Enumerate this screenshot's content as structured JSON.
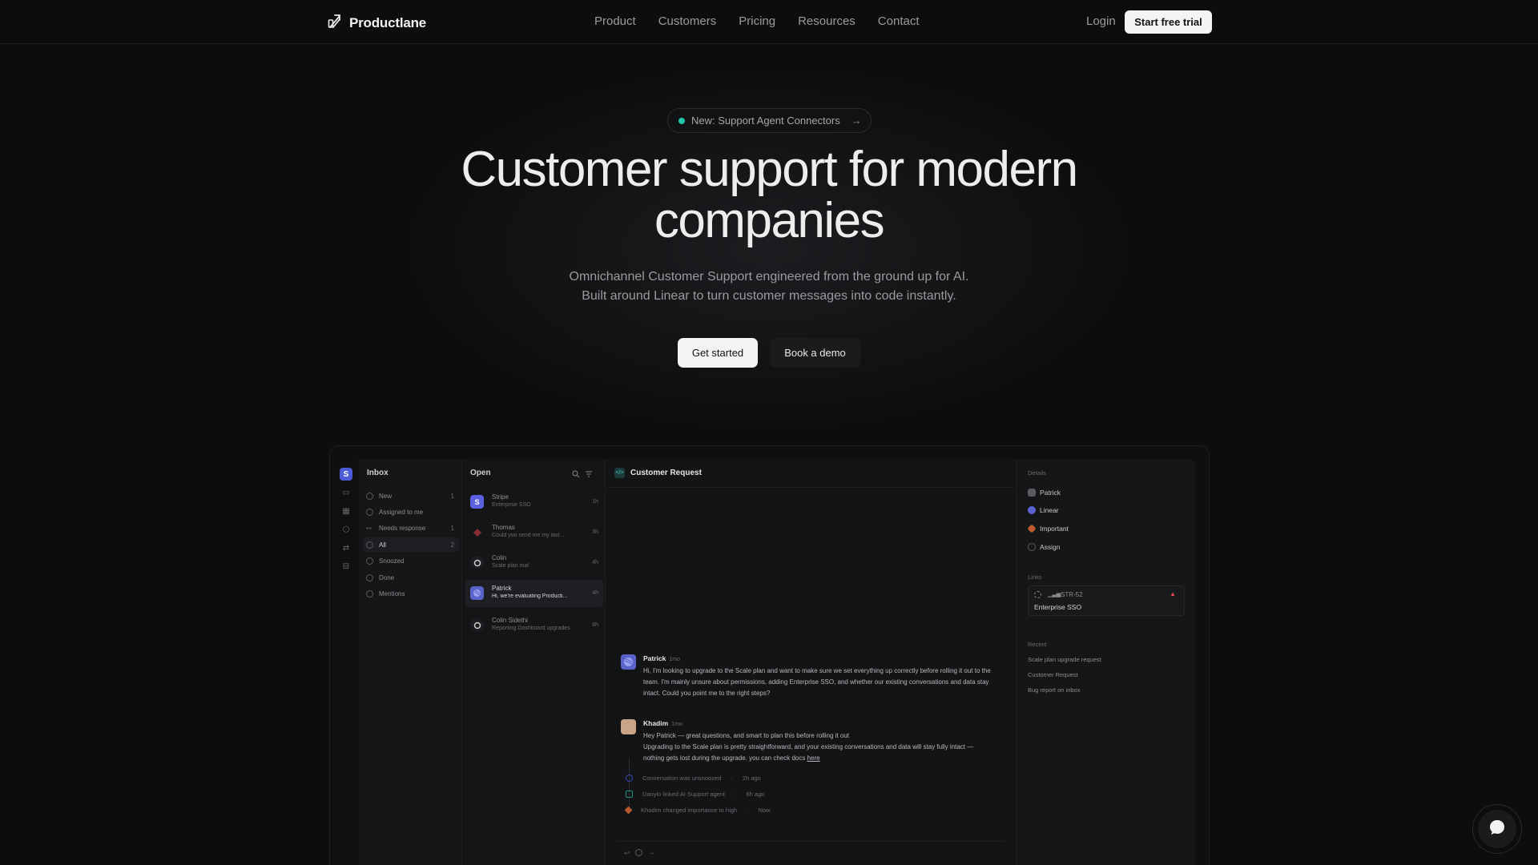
{
  "nav": {
    "brand": "Productlane",
    "links": [
      "Product",
      "Customers",
      "Pricing",
      "Resources",
      "Contact"
    ],
    "login": "Login",
    "cta": "Start free trial"
  },
  "hero": {
    "badge": "New: Support Agent Connectors",
    "badge_arrow": "→",
    "headline_line1": "Customer support for modern",
    "headline_line2": "companies",
    "sub_line1": "Omnichannel Customer Support engineered from the ground up for AI.",
    "sub_line2": "Built around Linear to turn customer messages into code instantly.",
    "primary_cta": "Get started",
    "secondary_cta": "Book a demo"
  },
  "app": {
    "workspace_initial": "S",
    "inbox": {
      "title": "Inbox",
      "items": [
        {
          "label": "New",
          "count": "1"
        },
        {
          "label": "Assigned to me",
          "count": ""
        },
        {
          "label": "Needs response",
          "count": "1"
        },
        {
          "label": "All",
          "count": "2"
        },
        {
          "label": "Snoozed",
          "count": ""
        },
        {
          "label": "Done",
          "count": ""
        },
        {
          "label": "Mentions",
          "count": ""
        }
      ]
    },
    "open": {
      "title": "Open",
      "conversations": [
        {
          "name": "Stripe",
          "preview": "Enterprise SSO",
          "time": "1h",
          "initial": "S",
          "color": "#5b5fe0"
        },
        {
          "name": "Thomas",
          "preview": "Could you send me my last...",
          "time": "3h",
          "initial": "",
          "color": "#2a1f22"
        },
        {
          "name": "Colin",
          "preview": "Scale plan trial",
          "time": "4h",
          "initial": "",
          "color": "#2a2b2e"
        },
        {
          "name": "Patrick",
          "preview": "Hi, we're evaluating Producti...",
          "time": "4h",
          "initial": "",
          "color": "#5a63c9"
        },
        {
          "name": "Colin Sidethi",
          "preview": "Reporting Dashboard upgrades",
          "time": "6h",
          "initial": "",
          "color": "#2a2b2e"
        }
      ]
    },
    "main": {
      "title": "Customer Request",
      "messages": [
        {
          "author": "Patrick",
          "when": "1mo",
          "body": "Hi, I'm looking to upgrade to the Scale plan and want to make sure we set everything up correctly before rolling it out to the team. I'm mainly unsure about permissions, adding Enterprise SSO, and whether our existing conversations and data stay intact. Could you point me to the right steps?"
        },
        {
          "author": "Khadim",
          "when": "1mo",
          "body_line1": "Hey Patrick — great questions, and smart to plan this before rolling it out",
          "body_line2": "Upgrading to the Scale plan is pretty straightforward, and your existing conversations and data will stay fully intact — nothing gets lost during the upgrade. you can check docs",
          "link": "here"
        }
      ],
      "events": [
        {
          "text": "Conversation was unsnoozed",
          "sep": "·",
          "time": "2h ago",
          "color": "#3b4bbf"
        },
        {
          "text": "Danylo linked AI Support agent",
          "sep": "·",
          "time": "6h ago",
          "color": "#1e8f88"
        },
        {
          "text": "Khadim changed importance to high",
          "sep": "·",
          "time": "Now",
          "color": "#b5562e"
        }
      ]
    },
    "side": {
      "details_label": "Details",
      "details": [
        {
          "label": "Patrick",
          "color": "#5a5b5e"
        },
        {
          "label": "Linear",
          "color": "#5b63d6"
        },
        {
          "label": "Important",
          "color": "#c05a2c"
        },
        {
          "label": "Assign",
          "color": "#5a5b5e"
        }
      ],
      "links_label": "Links",
      "link_id": "STR-52",
      "link_title": "Enterprise SSO",
      "recent_label": "Recent",
      "recent": [
        "Scale plan upgrade request",
        "Customer Request",
        "Bug report on inbox"
      ]
    }
  },
  "colors": {
    "accent_teal": "#1fc5a8",
    "background": "#0c0d0e",
    "primary_button": "#f4f4f4"
  },
  "icons": [
    "productlane-logo-icon",
    "arrow-right-icon",
    "search-icon",
    "filter-icon",
    "chat-bubble-icon"
  ]
}
